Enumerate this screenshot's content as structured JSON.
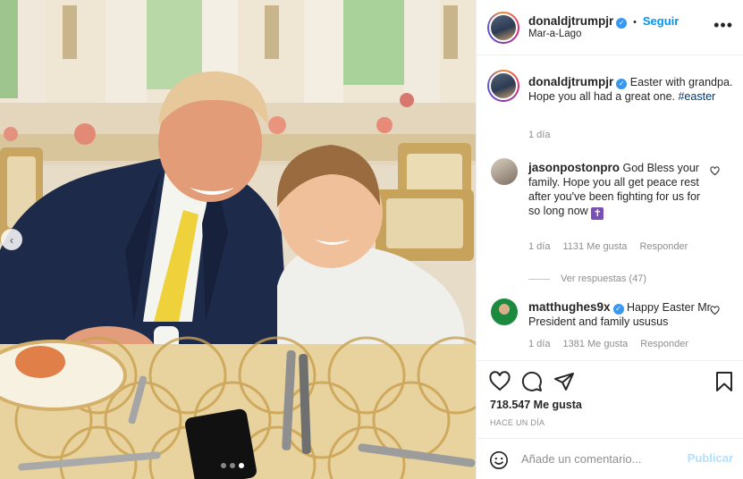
{
  "media": {
    "carousel": {
      "count": 3,
      "active_index": 2
    }
  },
  "header": {
    "username": "donaldjtrumpjr",
    "separator": "•",
    "follow_label": "Seguir",
    "location": "Mar-a-Lago",
    "more_icon": "more-options-icon"
  },
  "caption": {
    "username": "donaldjtrumpjr",
    "text": "Easter with grandpa. Hope you all had a great one. ",
    "hashtag": "#easter",
    "time": "1 día"
  },
  "comments": [
    {
      "username": "jasonpostonpro",
      "text": "God Bless your family. Hope you all get peace rest after you've been fighting for us for so long now",
      "emoji": "✝",
      "time": "1 día",
      "likes": "1131 Me gusta",
      "reply_label": "Responder",
      "view_replies": "Ver respuestas (47)"
    },
    {
      "username": "matthughes9x",
      "text": "Happy Easter Mr. President and family ususus",
      "time": "1 día",
      "likes": "1381 Me gusta",
      "reply_label": "Responder"
    }
  ],
  "actions": {
    "likes": "718.547 Me gusta",
    "date": "HACE UN DÍA"
  },
  "add_comment": {
    "placeholder": "Añade un comentario...",
    "publish_label": "Publicar"
  },
  "colors": {
    "accent": "#0095f6",
    "verified": "#3897f0",
    "muted": "#8e8e8e",
    "publish_disabled": "#b2dffc"
  }
}
